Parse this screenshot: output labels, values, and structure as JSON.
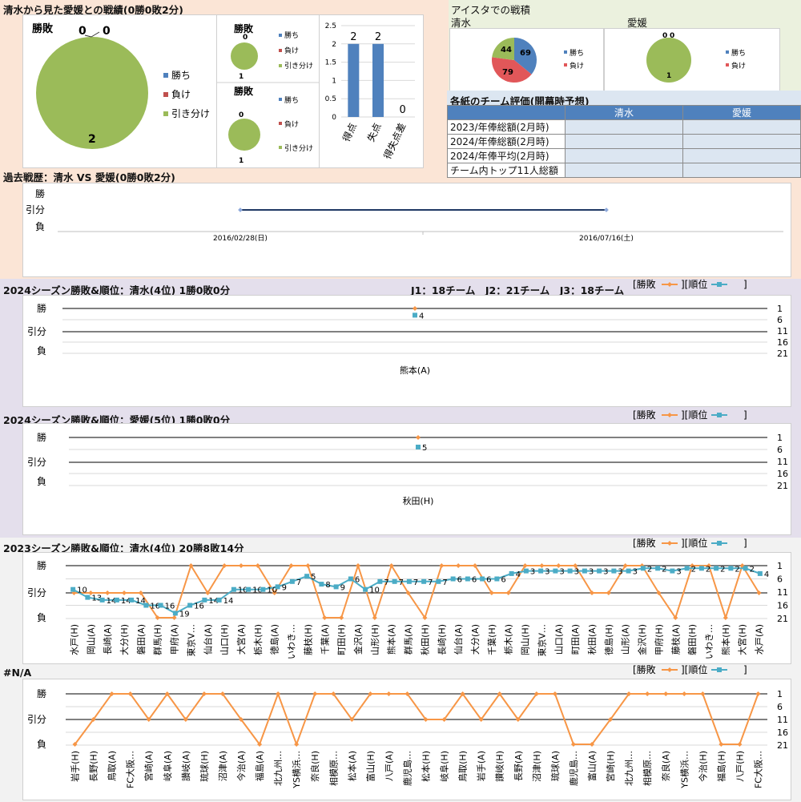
{
  "header": {
    "record_title": "清水から見た愛媛との戦績(0勝0敗2分)",
    "aisuta_title": "アイスタでの戦積",
    "eval_title": "各紙のチーム評価(開幕時予想)"
  },
  "pie_main": {
    "label": "勝敗",
    "values": [
      0,
      0,
      2
    ],
    "legend": [
      "勝ち",
      "負け",
      "引き分け"
    ],
    "colors": [
      "#4f81bd",
      "#c0504d",
      "#9bbb59"
    ]
  },
  "pie_small": [
    {
      "label": "勝敗",
      "values": [
        0,
        0,
        1
      ],
      "legend": [
        "勝ち",
        "負け",
        "引き分け"
      ]
    },
    {
      "label": "勝敗",
      "values": [
        0,
        0,
        1
      ],
      "legend": [
        "勝ち",
        "負け",
        "引き分け"
      ]
    }
  ],
  "chart_data": [
    {
      "type": "bar",
      "categories": [
        "得点",
        "失点",
        "得失点差"
      ],
      "values": [
        2,
        2,
        0
      ],
      "ylim": [
        0,
        2.5
      ],
      "yticks": [
        "0",
        "0.5",
        "1",
        "1.5",
        "2",
        "2.5"
      ],
      "color": "#4f81bd"
    },
    {
      "type": "pie",
      "team": "清水",
      "legend": [
        "勝ち",
        "負け"
      ],
      "values": [
        69,
        79,
        44
      ],
      "colors": [
        "#4f81bd",
        "#e15759",
        "#9bbb59"
      ]
    },
    {
      "type": "pie",
      "team": "愛媛",
      "legend": [
        "勝ち",
        "負け"
      ],
      "values": [
        0,
        0,
        1
      ],
      "colors": [
        "#4f81bd",
        "#e15759",
        "#9bbb59"
      ]
    },
    {
      "type": "line",
      "title": "過去戦歴：清水 VS 愛媛(0勝0敗2分)",
      "y_labels": [
        "勝",
        "引分",
        "負"
      ],
      "categories": [
        "2016/02/28(日)",
        "2016/07/16(土)"
      ],
      "results": [
        0,
        0
      ]
    },
    {
      "type": "line",
      "title": "2024シーズン勝敗&順位：清水(4位) 1勝0敗0分",
      "note": "J1：18チーム　J2：21チーム　J3：18チーム",
      "legend": [
        "[勝敗",
        "][順位",
        "]"
      ],
      "y_labels": [
        "勝",
        "引分",
        "負"
      ],
      "rank_ticks": [
        "1",
        "6",
        "11",
        "16",
        "21"
      ],
      "categories": [
        "熊本(A)"
      ],
      "results": [
        1
      ],
      "ranks": [
        4
      ]
    },
    {
      "type": "line",
      "title": "2024シーズン勝敗&順位：愛媛(5位) 1勝0敗0分",
      "legend": [
        "[勝敗",
        "][順位",
        "]"
      ],
      "y_labels": [
        "勝",
        "引分",
        "負"
      ],
      "rank_ticks": [
        "1",
        "6",
        "11",
        "16",
        "21"
      ],
      "categories": [
        "秋田(H)"
      ],
      "results": [
        1
      ],
      "ranks": [
        5
      ]
    },
    {
      "type": "line",
      "title": "2023シーズン勝敗&順位：清水(4位) 20勝8敗14分",
      "legend": [
        "[勝敗",
        "][順位",
        "]"
      ],
      "y_labels": [
        "勝",
        "引分",
        "負"
      ],
      "rank_ticks": [
        "1",
        "6",
        "11",
        "16",
        "21"
      ],
      "categories": [
        "水戸(H)",
        "岡山(A)",
        "長崎(A)",
        "大分(H)",
        "磐田(A)",
        "群馬(H)",
        "甲府(A)",
        "東京V…",
        "仙台(A)",
        "山口(H)",
        "大宮(A)",
        "栃木(H)",
        "徳島(A)",
        "いわき…",
        "藤枝(H)",
        "千葉(A)",
        "町田(H)",
        "金沢(A)",
        "山形(H)",
        "熊本(A)",
        "群馬(A)",
        "秋田(H)",
        "長崎(H)",
        "仙台(A)",
        "大分(A)",
        "千葉(H)",
        "栃木(A)",
        "岡山(H)",
        "東京V…",
        "山口(A)",
        "町田(A)",
        "秋田(A)",
        "徳島(H)",
        "山形(A)",
        "金沢(H)",
        "甲府(H)",
        "藤枝(A)",
        "磐田(H)",
        "いわき…",
        "熊本(H)",
        "大宮(H)",
        "水戸(A)"
      ],
      "results": [
        0,
        0,
        0,
        0,
        0,
        -1,
        -1,
        1,
        0,
        1,
        1,
        1,
        0,
        1,
        1,
        -1,
        -1,
        1,
        -1,
        1,
        0,
        -1,
        1,
        1,
        1,
        0,
        0,
        1,
        1,
        1,
        1,
        0,
        0,
        1,
        1,
        0,
        -1,
        1,
        1,
        -1,
        1,
        0
      ],
      "ranks": [
        10,
        13,
        14,
        14,
        14,
        16,
        16,
        19,
        16,
        14,
        14,
        10,
        10,
        10,
        9,
        7,
        5,
        8,
        9,
        6,
        10,
        7,
        7,
        7,
        7,
        7,
        6,
        6,
        6,
        6,
        4,
        3,
        3,
        3,
        3,
        3,
        3,
        3,
        3,
        2,
        2,
        3,
        2,
        2,
        2,
        2,
        2,
        4
      ]
    },
    {
      "type": "line",
      "title": "#N/A",
      "legend": [
        "[勝敗",
        "][順位",
        "]"
      ],
      "y_labels": [
        "勝",
        "引分",
        "負"
      ],
      "rank_ticks": [
        "1",
        "6",
        "11",
        "16",
        "21"
      ],
      "categories": [
        "岩手(H)",
        "長野(H)",
        "鳥取(A)",
        "FC大阪…",
        "宮崎(A)",
        "岐阜(A)",
        "讃岐(A)",
        "琉球(H)",
        "沼津(A)",
        "今治(A)",
        "福島(A)",
        "北九州…",
        "YS横浜…",
        "奈良(H)",
        "相模原…",
        "松本(A)",
        "富山(H)",
        "八戸(A)",
        "鹿児島…",
        "松本(H)",
        "岐阜(H)",
        "鳥取(H)",
        "岩手(A)",
        "讃岐(H)",
        "長野(A)",
        "沼津(H)",
        "琉球(A)",
        "鹿児島…",
        "富山(A)",
        "宮崎(H)",
        "北九州…",
        "相模原…",
        "奈良(A)",
        "YS横浜…",
        "今治(H)",
        "福島(H)",
        "八戸(H)",
        "FC大阪…"
      ],
      "results": [
        -1,
        0,
        1,
        1,
        0,
        1,
        0,
        1,
        1,
        0,
        -1,
        1,
        -1,
        1,
        1,
        0,
        1,
        1,
        1,
        0,
        0,
        1,
        0,
        1,
        0,
        1,
        1,
        -1,
        -1,
        0,
        1,
        1,
        1,
        1,
        1,
        -1,
        -1,
        1
      ]
    }
  ]
}
